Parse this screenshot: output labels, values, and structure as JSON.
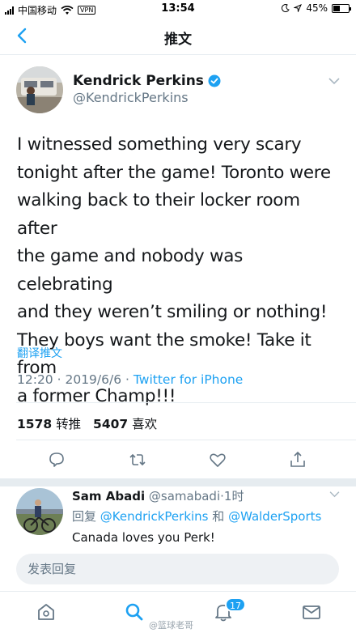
{
  "status_bar": {
    "carrier": "中国移动",
    "vpn": "VPN",
    "time": "13:54",
    "battery": "45%",
    "battery_level": 0.45
  },
  "nav": {
    "title": "推文",
    "back_icon": "chevron-left-icon"
  },
  "tweet": {
    "author_name": "Kendrick Perkins",
    "author_handle": "@KendrickPerkins",
    "lines": [
      "I witnessed something very scary",
      "tonight after the game! Toronto were",
      "walking back to their locker room after",
      "the game and nobody was celebrating",
      "and they weren’t smiling or nothing!",
      "They boys want the smoke! Take it from",
      "a former Champ!!!"
    ],
    "translate": "翻译推文",
    "time": "12:20",
    "date": "2019/6/6",
    "client": "Twitter for iPhone",
    "retweets_count": "1578",
    "retweets_label": "转推",
    "likes_count": "5407",
    "likes_label": "喜欢"
  },
  "reply": {
    "name": "Sam Abadi",
    "handle": "@samabadi",
    "age": "1时",
    "reply_prefix": "回复",
    "mention1": "@KendrickPerkins",
    "conj": "和",
    "mention2": "@WalderSports",
    "text": "Canada loves you Perk!"
  },
  "compose": {
    "placeholder": "发表回复"
  },
  "tabbar": {
    "badge": "17"
  },
  "watermark": "@篮球老哥",
  "colors": {
    "accent": "#1da1f2",
    "muted": "#657786",
    "text": "#14171a",
    "divider": "#e6ecf0"
  }
}
